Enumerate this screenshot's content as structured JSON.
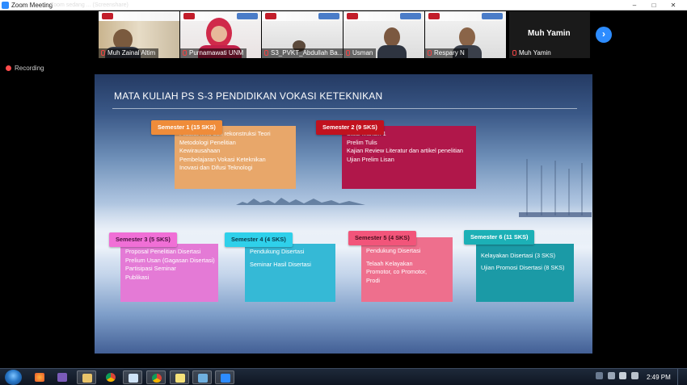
{
  "window": {
    "title": "Zoom Meeting",
    "faded_subtitle": "Zoom sedang ... (Screenshare)"
  },
  "participants": [
    {
      "name": "Muh Zainal Altim"
    },
    {
      "name": "Purnamawati UNM"
    },
    {
      "name": "S3_PVKT_Abdullah Ba..."
    },
    {
      "name": "Usman"
    },
    {
      "name": "Respary N"
    }
  ],
  "active_speaker": {
    "name": "Muh Yamin",
    "tile_name": "Muh Yamin"
  },
  "recording": {
    "label": "Recording"
  },
  "slide": {
    "title": "MATA KULIAH PS S-3 PENDIDIKAN VOKASI KETEKNIKAN",
    "semesters": [
      {
        "label": "Semester 1 (15 SKS)",
        "tab_color": "#ef8c3a",
        "box_color": "#e8a76a",
        "items": [
          "Filsafat Ilmu dan rekonstruksi Teori",
          "Metodologi Penelitian",
          "Kewirausahaan",
          "Pembelajaran Vokasi Keteknikan",
          "Inovasi dan Difusi Teknologi"
        ]
      },
      {
        "label": "Semester 2 (9 SKS)",
        "tab_color": "#c1121f",
        "box_color": "#b0174a",
        "items": [
          "Studi Mandiri 1",
          "Prelim Tulis",
          "Kajian Review Literatur dan artikel penelitian",
          "Ujian Prelim Lisan"
        ]
      },
      {
        "label": "Semester 3 (5 SKS)",
        "tab_color": "#f06fd6",
        "box_color": "#e47ad6",
        "items": [
          "Proposal Penelitian Disertasi",
          "Prelium Usan (Gagasan Disertasi)",
          "Partisipasi Seminar",
          "Publikasi"
        ]
      },
      {
        "label": "Semester 4 (4 SKS)",
        "tab_color": "#2fd0ea",
        "box_color": "#35b9d6",
        "items": [
          "Pendukung Disertasi",
          "Seminar Hasil Disertasi"
        ]
      },
      {
        "label": "Semester 5 (4 SKS)",
        "tab_color": "#f2557a",
        "box_color": "#ee6f8d",
        "items": [
          "Pendukung Disertasi",
          "Telaah Kelayakan",
          "Promotor, co Promotor,",
          "Prodi"
        ]
      },
      {
        "label": "Semester 6 (11 SKS)",
        "tab_color": "#1cb0b6",
        "box_color": "#1b9aa6",
        "items": [
          "Kelayakan Disertasi (3 SKS)",
          "Ujian Promosi Disertasi (8 SKS)"
        ]
      }
    ]
  },
  "taskbar": {
    "clock": "2:49 PM",
    "apps": [
      "firefox-icon",
      "visual-studio-icon",
      "file-explorer-icon",
      "chrome-icon",
      "notepad-icon",
      "chrome-icon",
      "sticky-notes-icon",
      "photos-icon",
      "zoom-icon"
    ]
  }
}
